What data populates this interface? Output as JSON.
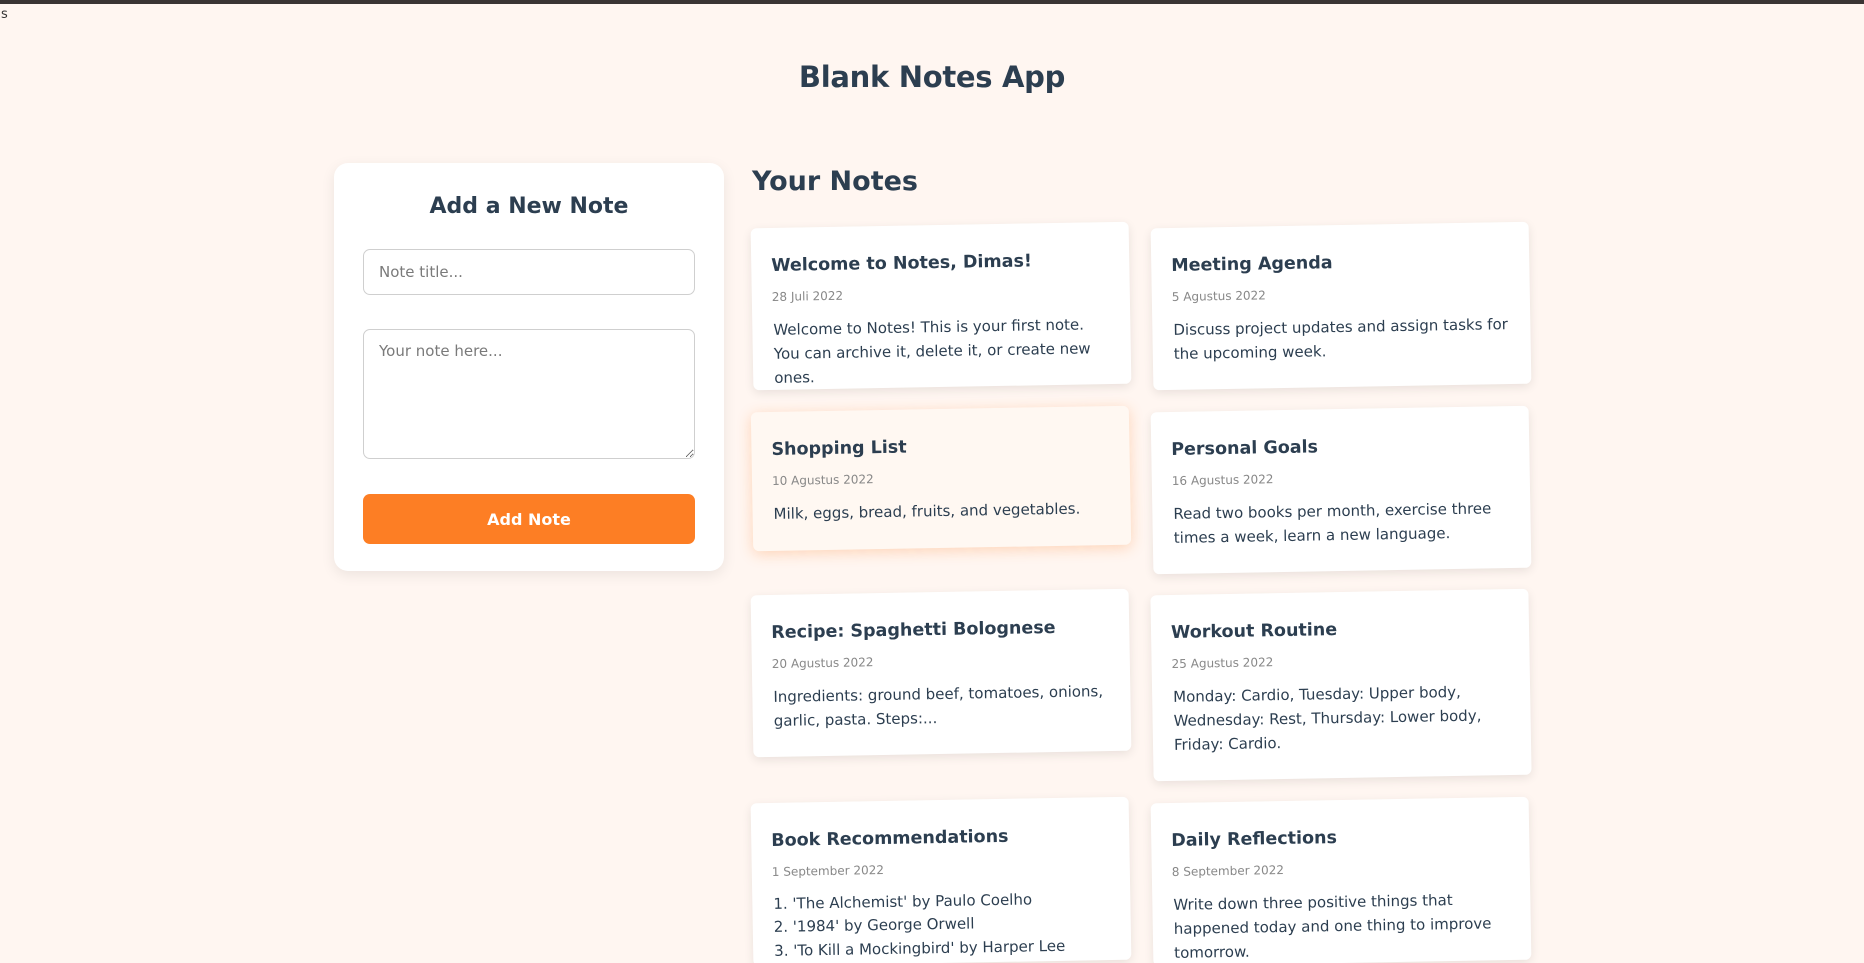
{
  "window": {
    "corner_text": "s"
  },
  "app": {
    "title": "Blank Notes App"
  },
  "form": {
    "heading": "Add a New Note",
    "title_placeholder": "Note title...",
    "body_placeholder": "Your note here...",
    "submit_label": "Add Note"
  },
  "notes_section": {
    "heading": "Your Notes",
    "notes": [
      {
        "title": "Welcome to Notes, Dimas!",
        "date": "28 Juli 2022",
        "body": "Welcome to Notes! This is your first note. You can archive it, delete it, or create new ones."
      },
      {
        "title": "Meeting Agenda",
        "date": "5 Agustus 2022",
        "body": "Discuss project updates and assign tasks for the upcoming week."
      },
      {
        "title": "Shopping List",
        "date": "10 Agustus 2022",
        "body": "Milk, eggs, bread, fruits, and vegetables."
      },
      {
        "title": "Personal Goals",
        "date": "16 Agustus 2022",
        "body": "Read two books per month, exercise three times a week, learn a new language."
      },
      {
        "title": "Recipe: Spaghetti Bolognese",
        "date": "20 Agustus 2022",
        "body": "Ingredients: ground beef, tomatoes, onions, garlic, pasta. Steps:..."
      },
      {
        "title": "Workout Routine",
        "date": "25 Agustus 2022",
        "body": "Monday: Cardio, Tuesday: Upper body, Wednesday: Rest, Thursday: Lower body, Friday: Cardio."
      },
      {
        "title": "Book Recommendations",
        "date": "1 September 2022",
        "list": [
          "1. 'The Alchemist' by Paulo Coelho",
          "2. '1984' by George Orwell",
          "3. 'To Kill a Mockingbird' by Harper Lee"
        ]
      },
      {
        "title": "Daily Reflections",
        "date": "8 September 2022",
        "body": "Write down three positive things that happened today and one thing to improve tomorrow."
      }
    ]
  },
  "colors": {
    "background": "#fff6f1",
    "accent": "#fd7e24",
    "text": "#2c3e50",
    "highlight_card": "#fff8f2"
  }
}
